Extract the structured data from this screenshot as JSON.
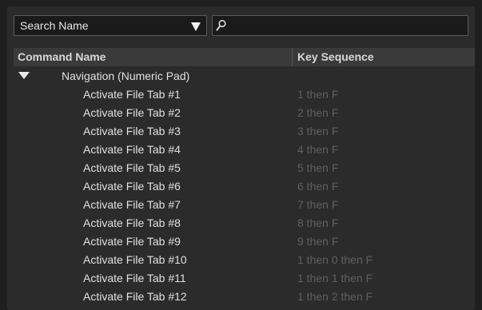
{
  "search": {
    "mode_label": "Search Name",
    "query": "",
    "placeholder": ""
  },
  "columns": {
    "name": "Command Name",
    "key": "Key Sequence"
  },
  "group": {
    "label": "Navigation (Numeric Pad)",
    "expanded": true
  },
  "rows": [
    {
      "name": "Activate File Tab #1",
      "key": "1 then F"
    },
    {
      "name": "Activate File Tab #2",
      "key": "2 then F"
    },
    {
      "name": "Activate File Tab #3",
      "key": "3 then F"
    },
    {
      "name": "Activate File Tab #4",
      "key": "4 then F"
    },
    {
      "name": "Activate File Tab #5",
      "key": "5 then F"
    },
    {
      "name": "Activate File Tab #6",
      "key": "6 then F"
    },
    {
      "name": "Activate File Tab #7",
      "key": "7 then F"
    },
    {
      "name": "Activate File Tab #8",
      "key": "8 then F"
    },
    {
      "name": "Activate File Tab #9",
      "key": "9 then F"
    },
    {
      "name": "Activate File Tab #10",
      "key": "1 then 0 then F"
    },
    {
      "name": "Activate File Tab #11",
      "key": "1 then 1 then F"
    },
    {
      "name": "Activate File Tab #12",
      "key": "1 then 2 then F"
    }
  ],
  "icons": {
    "search": "search-icon",
    "dropdown": "dropdown-arrow-icon",
    "expand": "expand-triangle-icon"
  },
  "colors": {
    "background": "#1f1f1f",
    "panel": "#2b2b2b",
    "header": "#3a3a3a",
    "text": "#e0e0e0",
    "key_text": "#5f5f5f"
  }
}
